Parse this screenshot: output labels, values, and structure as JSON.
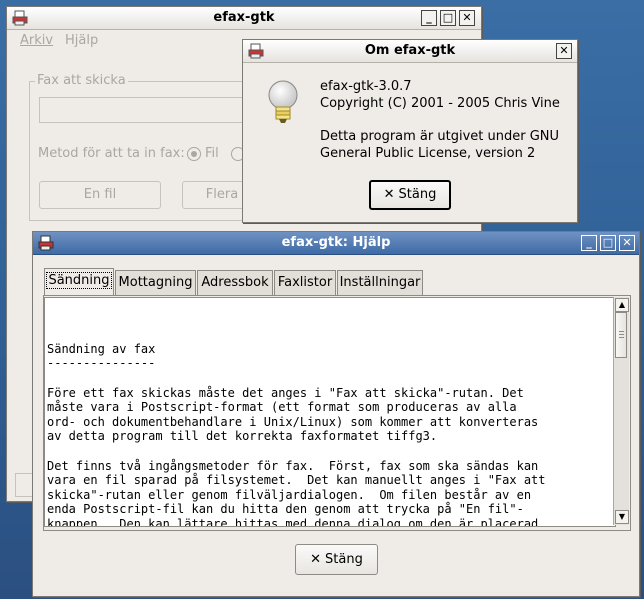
{
  "main_window": {
    "title": "efax-gtk",
    "menu": [
      "Arkiv",
      "Hjälp"
    ],
    "frame_label": "Fax att skicka",
    "method_label": "Metod för att ta in fax:",
    "radio_file": "Fil",
    "btn_single": "En fil",
    "btn_multi": "Flera"
  },
  "about_window": {
    "title": "Om efax-gtk",
    "version": "efax-gtk-3.0.7",
    "copyright": "Copyright (C) 2001 - 2005 Chris Vine",
    "license_line1": "Detta program är utgivet under GNU",
    "license_line2": "General Public License, version 2",
    "close_label": "Stäng"
  },
  "help_window": {
    "title": "efax-gtk: Hjälp",
    "tabs": [
      "Sändning",
      "Mottagning",
      "Adressbok",
      "Faxlistor",
      "Inställningar"
    ],
    "close_label": "Stäng",
    "content": "\nSändning av fax\n---------------\n\nFöre ett fax skickas måste det anges i \"Fax att skicka\"-rutan. Det\nmåste vara i Postscript-format (ett format som produceras av alla\nord- och dokumentbehandlare i Unix/Linux) som kommer att konverteras\nav detta program till det korrekta faxformatet tiffg3.\n\nDet finns två ingångsmetoder för fax.  Först, fax som ska sändas kan\nvara en fil sparad på filsystemet.  Det kan manuellt anges i \"Fax att\nskicka\"-rutan eller genom filväljardialogen.  Om filen består av en\nenda Postscript-fil kan du hitta den genom att trycka på \"En fil\"-\nknappen.  Den kan lättare hittas med denna dialog om den är placerad\ni katalogen $HOME/faxout."
  }
}
